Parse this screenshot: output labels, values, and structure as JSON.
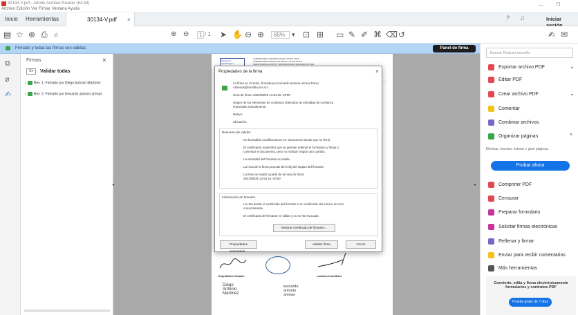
{
  "window": {
    "title": "30134-V.pdf - Adobe Acrobat Reader (64-bit)",
    "menu": "Archivo  Edición  Ver  Firmar  Ventana  Ayuda"
  },
  "tabs": {
    "home": "Inicio",
    "tools": "Herramientas",
    "document": "30134-V.pdf",
    "close": "×",
    "signin": "Iniciar sesión"
  },
  "toolbar": {
    "page_current": "1",
    "page_total": "/ 1",
    "zoom": "65%"
  },
  "signature_bar": {
    "message": "Firmado y todas las firmas son válidas.",
    "panel_button": "Panel de firma"
  },
  "signatures_panel": {
    "header": "Firmas",
    "close": "×",
    "validate_all": "Validar todas",
    "rows": [
      "Rev. 1: Firmado por Diego Antonio Martínez",
      "Rev. 2: Firmado por leonardo antonio arenas"
    ]
  },
  "dialog": {
    "title": "Propiedades de la firma",
    "close": "×",
    "line1": "La firma es VÁLIDA, firmada por leonardo antonio arenas bravo",
    "line1b": "<larenas@ensfalucom.cl>.",
    "sign_time": "Hora de firma:  2022/08/26 14:54:16 -03'00'",
    "trust1": "Origen de los elementos de confianza obtenidos de identidad de confianza",
    "trust2": "importada manualmente.",
    "reason": "Motivo:",
    "location": "Ubicación:",
    "summary_header": "Resumen de validez",
    "s1": "No ha habido modificaciones en: documento desde que se firmó.",
    "s2a": "El certificador especificó que se permite rellenar el formulario y firmar y",
    "s2b": "comentar el documento, pero no realizar ningún otro cambio.",
    "s3": "La identidad del firmante es válida.",
    "s4": "La hora de la firma procede del reloj del equipo del firmante.",
    "s5a": "La firma se validó a partir de la hora de firma:",
    "s5b": "2022/08/26 14:54:16 -03'00'",
    "signer_header": "Información de firmante",
    "i1a": "La ruta desde el certificado del firmante a un certificado del emisor se creó",
    "i1b": "correctamente.",
    "i2": "El certificado del firmante es válido y no se ha revocado.",
    "show_cert": "Mostrar certificado de firmante...",
    "advanced": "Propiedades avanzadas...",
    "validate": "Validar firma",
    "close_btn": "Cerrar"
  },
  "pdf_page": {
    "lab_header1": "LABORATORIO AGROBIOLOGICO SOCIO LTDA.",
    "lab_header2": "LABORATORIO OFICIAL DE VINOS Y ALCOHOLES",
    "lab_header3": "SEGÚN RESOLUCIÓN Nº 1983 MINISTERIO DE AGRICULTURA",
    "signer1_name": "Diego Martínez González",
    "signer2_name": "Leonardo Arenas Bravo",
    "stamp1a": "Diego",
    "stamp1b": "Antonio",
    "stamp1c": "Martínez",
    "stamp2a": "leonardo",
    "stamp2b": "antonio",
    "stamp2c": "arenas"
  },
  "right_panel": {
    "search_placeholder": "Buscar Reducir tamaño",
    "items": [
      {
        "label": "Exportar archivo PDF",
        "icon": "export-pdf-icon",
        "color": "#e34850",
        "chevron": "⌄"
      },
      {
        "label": "Editar PDF",
        "icon": "edit-pdf-icon",
        "color": "#e34850",
        "chevron": ""
      },
      {
        "label": "Crear archivo PDF",
        "icon": "create-pdf-icon",
        "color": "#e34850",
        "chevron": "⌄"
      },
      {
        "label": "Comentar",
        "icon": "comment-icon",
        "color": "#f5c11c",
        "chevron": ""
      },
      {
        "label": "Combinar archivos",
        "icon": "combine-files-icon",
        "color": "#7b68c6",
        "chevron": ""
      },
      {
        "label": "Organizar páginas",
        "icon": "organize-pages-icon",
        "color": "#3aa64a",
        "chevron": "^"
      }
    ],
    "organize_desc": "Eliminar, insertar, extraer y girar páginas.",
    "try_now": "Probar ahora",
    "items2": [
      {
        "label": "Comprimir PDF",
        "icon": "compress-pdf-icon",
        "color": "#e34850"
      },
      {
        "label": "Censurar",
        "icon": "redact-icon",
        "color": "#e34850"
      },
      {
        "label": "Preparar formulario",
        "icon": "prepare-form-icon",
        "color": "#c6359d"
      },
      {
        "label": "Solicitar firmas electrónicas",
        "icon": "request-signature-icon",
        "color": "#c6359d"
      },
      {
        "label": "Rellenar y firmar",
        "icon": "fill-sign-icon",
        "color": "#7b68c6"
      },
      {
        "label": "Enviar para recibir comentarios",
        "icon": "send-comments-icon",
        "color": "#f5c11c"
      },
      {
        "label": "Más herramientas",
        "icon": "more-tools-icon",
        "color": "#555555"
      }
    ],
    "promo_text": "Convierte, edita y firma electrónicamente formularios y contratos PDF",
    "promo_button": "Prueba gratis de 7 días"
  }
}
